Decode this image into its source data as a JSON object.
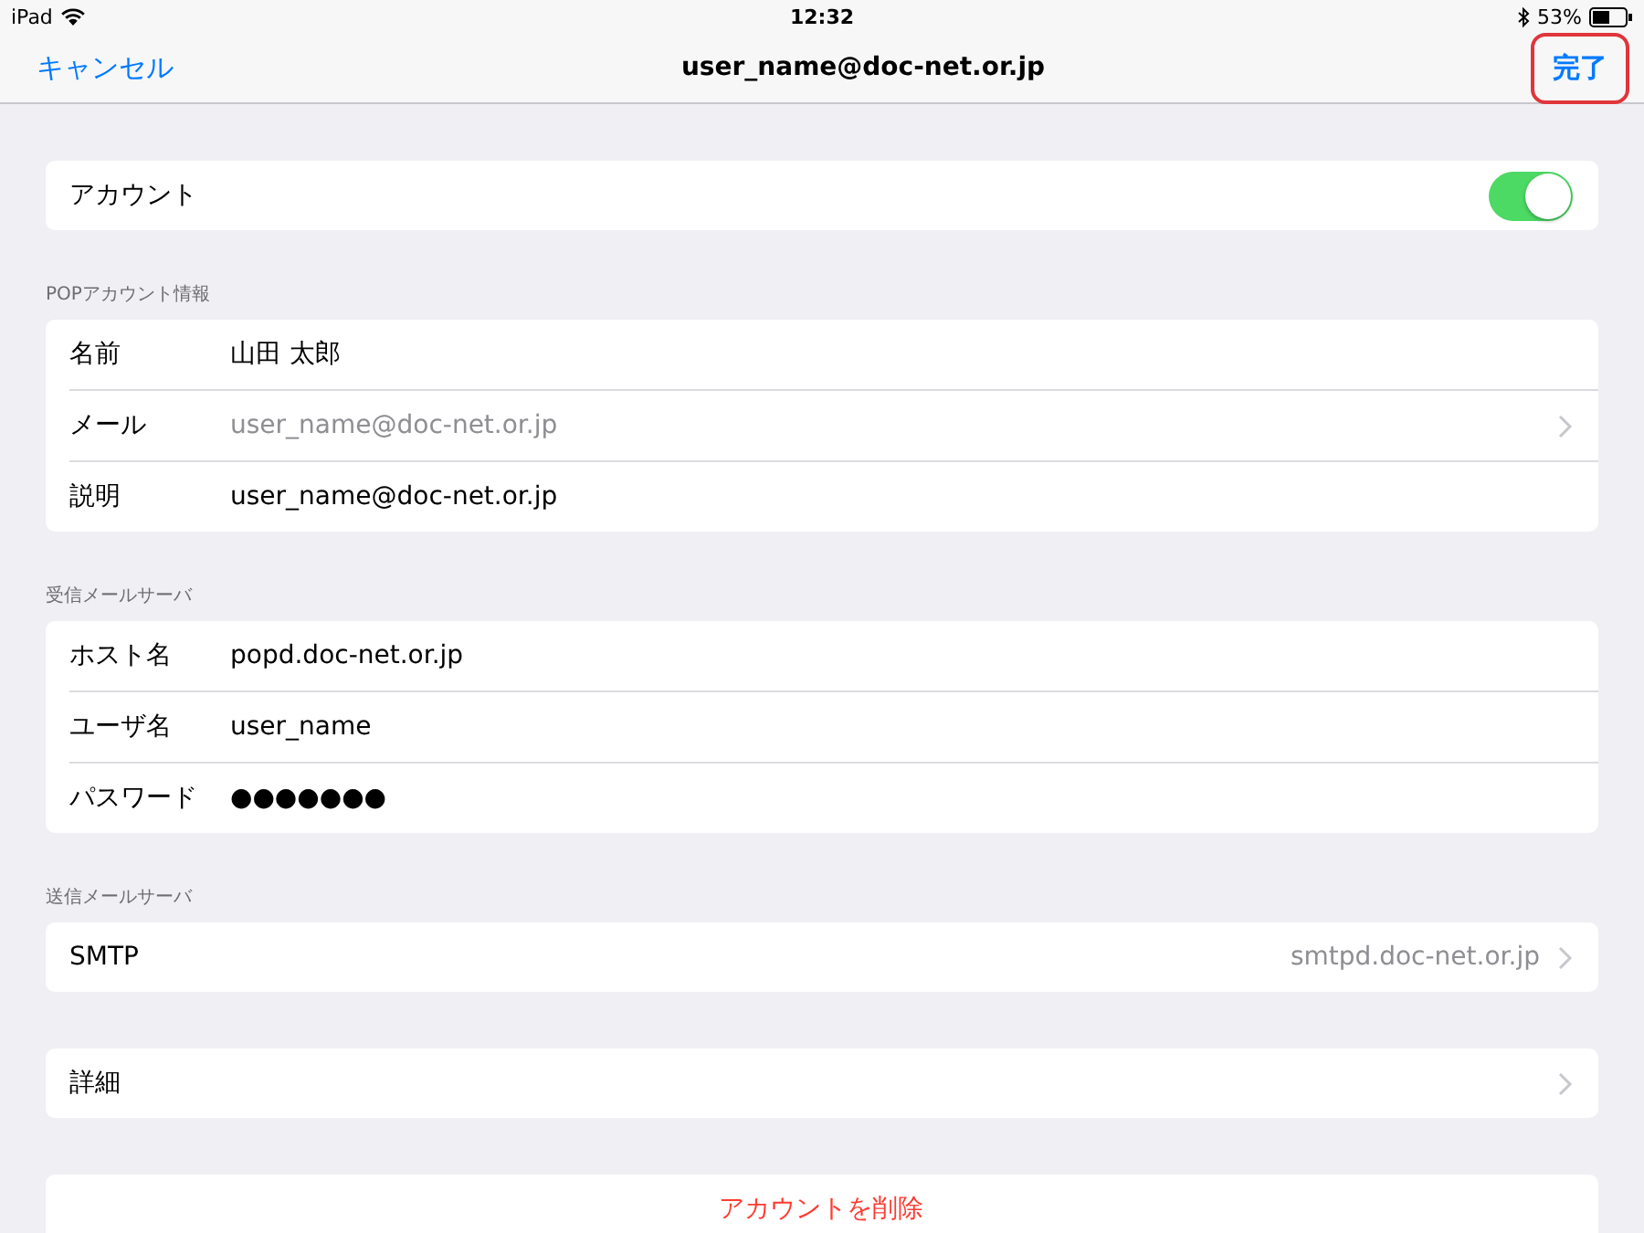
{
  "status_bar": {
    "device": "iPad",
    "time": "12:32",
    "battery": "53%"
  },
  "nav": {
    "cancel": "キャンセル",
    "title": "user_name@doc-net.or.jp",
    "done": "完了",
    "done_highlighted": true
  },
  "sections": [
    {
      "rows": [
        {
          "kind": "toggle",
          "label": "アカウント",
          "on": true
        }
      ]
    },
    {
      "header": "POPアカウント情報",
      "rows": [
        {
          "kind": "field",
          "label": "名前",
          "value": "山田 太郎",
          "dimmed": false,
          "chevron": false
        },
        {
          "kind": "field",
          "label": "メール",
          "value": "user_name@doc-net.or.jp",
          "dimmed": true,
          "chevron": true
        },
        {
          "kind": "field",
          "label": "説明",
          "value": "user_name@doc-net.or.jp",
          "dimmed": false,
          "chevron": false
        }
      ]
    },
    {
      "header": "受信メールサーバ",
      "rows": [
        {
          "kind": "field",
          "label": "ホスト名",
          "value": "popd.doc-net.or.jp",
          "dimmed": false,
          "chevron": false
        },
        {
          "kind": "field",
          "label": "ユーザ名",
          "value": "user_name",
          "dimmed": false,
          "chevron": false
        },
        {
          "kind": "field",
          "label": "パスワード",
          "value": "●●●●●●●",
          "dimmed": false,
          "chevron": false
        }
      ]
    },
    {
      "header": "送信メールサーバ",
      "rows": [
        {
          "kind": "link",
          "label": "SMTP",
          "value": "smtpd.doc-net.or.jp"
        }
      ]
    },
    {
      "rows": [
        {
          "kind": "link",
          "label": "詳細"
        }
      ]
    },
    {
      "rows": [
        {
          "kind": "destructive",
          "label": "アカウントを削除"
        }
      ]
    }
  ]
}
